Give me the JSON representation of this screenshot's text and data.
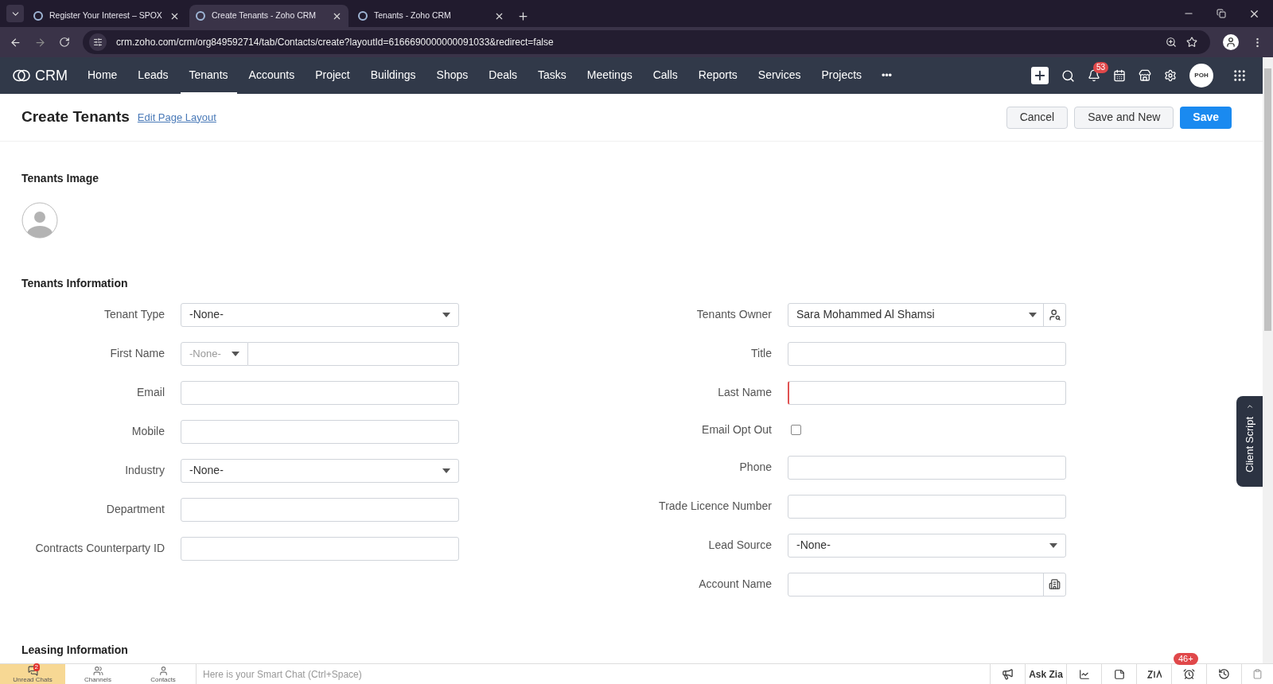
{
  "browser": {
    "tabs": [
      {
        "title": "Register Your Interest – SPOX",
        "selected": false
      },
      {
        "title": "Create Tenants - Zoho CRM",
        "selected": true
      },
      {
        "title": "Tenants - Zoho CRM",
        "selected": false
      }
    ],
    "url": "crm.zoho.com/crm/org849592714/tab/Contacts/create?layoutId=6166690000000091033&redirect=false"
  },
  "nav": {
    "logo": "CRM",
    "items": [
      {
        "label": "Home",
        "selected": false
      },
      {
        "label": "Leads",
        "selected": false
      },
      {
        "label": "Tenants",
        "selected": true
      },
      {
        "label": "Accounts",
        "selected": false
      },
      {
        "label": "Project",
        "selected": false
      },
      {
        "label": "Buildings",
        "selected": false
      },
      {
        "label": "Shops",
        "selected": false
      },
      {
        "label": "Deals",
        "selected": false
      },
      {
        "label": "Tasks",
        "selected": false
      },
      {
        "label": "Meetings",
        "selected": false
      },
      {
        "label": "Calls",
        "selected": false
      },
      {
        "label": "Reports",
        "selected": false
      },
      {
        "label": "Services",
        "selected": false
      },
      {
        "label": "Projects",
        "selected": false
      }
    ],
    "more": "•••",
    "notifications": "53",
    "avatar": "POH"
  },
  "header": {
    "title": "Create Tenants",
    "link": "Edit Page Layout",
    "buttons": [
      {
        "label": "Cancel",
        "kind": "secondary"
      },
      {
        "label": "Save and New",
        "kind": "secondary"
      },
      {
        "label": "Save",
        "kind": "primary"
      }
    ]
  },
  "image_section": {
    "title": "Tenants Image"
  },
  "info_section": {
    "title": "Tenants Information",
    "left": [
      {
        "label": "Tenant Type",
        "kind": "select",
        "value": "-None-"
      },
      {
        "label": "First Name",
        "kind": "prefixed",
        "prefix": "-None-"
      },
      {
        "label": "Email",
        "kind": "text"
      },
      {
        "label": "Mobile",
        "kind": "text"
      },
      {
        "label": "Industry",
        "kind": "select",
        "value": "-None-"
      },
      {
        "label": "Department",
        "kind": "text"
      },
      {
        "label": "Contracts Counterparty ID",
        "kind": "text"
      }
    ],
    "right": [
      {
        "label": "Tenants Owner",
        "kind": "user",
        "value": "Sara Mohammed Al Shamsi"
      },
      {
        "label": "Title",
        "kind": "text"
      },
      {
        "label": "Last Name",
        "kind": "text",
        "required": true
      },
      {
        "label": "Email Opt Out",
        "kind": "checkbox",
        "checked": false
      },
      {
        "label": "Phone",
        "kind": "text"
      },
      {
        "label": "Trade Licence Number",
        "kind": "text"
      },
      {
        "label": "Lead Source",
        "kind": "select",
        "value": "-None-"
      },
      {
        "label": "Account Name",
        "kind": "account"
      }
    ]
  },
  "leasing_section": {
    "title": "Leasing Information"
  },
  "client_script": "Client Script",
  "bottom_bar": {
    "chats": [
      {
        "label": "Unread Chats",
        "kind": "unread",
        "badge": "2",
        "selected": true
      },
      {
        "label": "Channels",
        "kind": "channels",
        "selected": false
      },
      {
        "label": "Contacts",
        "kind": "contacts",
        "selected": false
      }
    ],
    "smart_chat_placeholder": "Here is your Smart Chat (Ctrl+Space)",
    "ask_zia": "Ask Zia",
    "reminder_badge": "46+"
  }
}
